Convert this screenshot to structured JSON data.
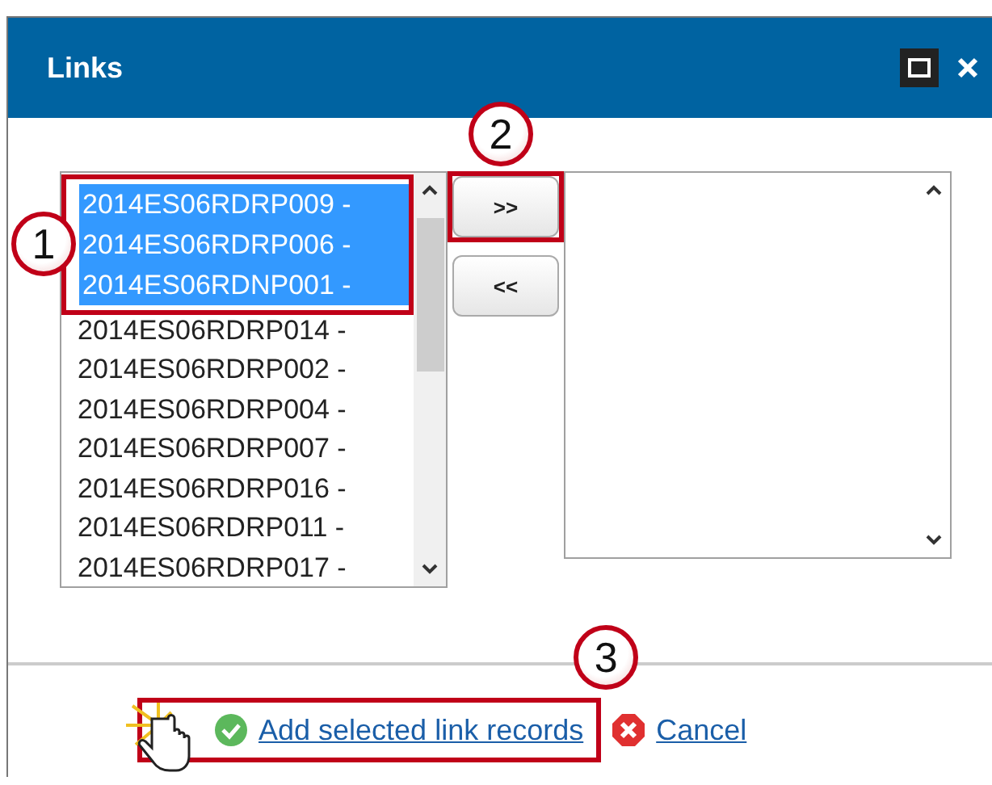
{
  "window": {
    "title": "Links"
  },
  "available": {
    "callout": "1",
    "items": [
      {
        "label": "2014ES06RDRP009 -",
        "selected": true
      },
      {
        "label": "2014ES06RDRP006 -",
        "selected": true
      },
      {
        "label": "2014ES06RDNP001 -",
        "selected": true
      },
      {
        "label": "2014ES06RDRP014 -",
        "selected": false
      },
      {
        "label": "2014ES06RDRP002 -",
        "selected": false
      },
      {
        "label": "2014ES06RDRP004 -",
        "selected": false
      },
      {
        "label": "2014ES06RDRP007 -",
        "selected": false
      },
      {
        "label": "2014ES06RDRP016 -",
        "selected": false
      },
      {
        "label": "2014ES06RDRP011 -",
        "selected": false
      },
      {
        "label": "2014ES06RDRP017 -",
        "selected": false
      }
    ]
  },
  "move_buttons": {
    "callout": "2",
    "add": ">>",
    "remove": "<<"
  },
  "footer": {
    "callout": "3",
    "confirm": "Add selected link records",
    "cancel": "Cancel"
  }
}
